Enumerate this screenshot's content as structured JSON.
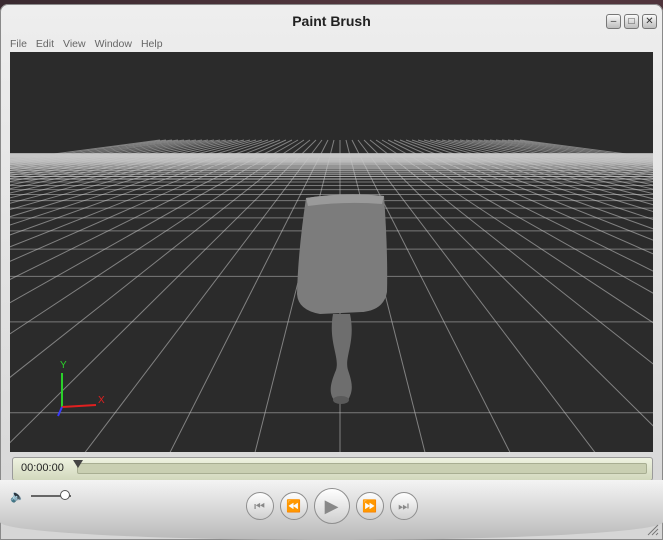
{
  "window": {
    "title": "Paint Brush"
  },
  "menu": [
    "File",
    "Edit",
    "View",
    "Window",
    "Help"
  ],
  "axes": {
    "y_label": "Y",
    "x_label": "X"
  },
  "timeline": {
    "timecode": "00:00:00",
    "progress": 0
  },
  "volume": {
    "level": 0.85
  }
}
